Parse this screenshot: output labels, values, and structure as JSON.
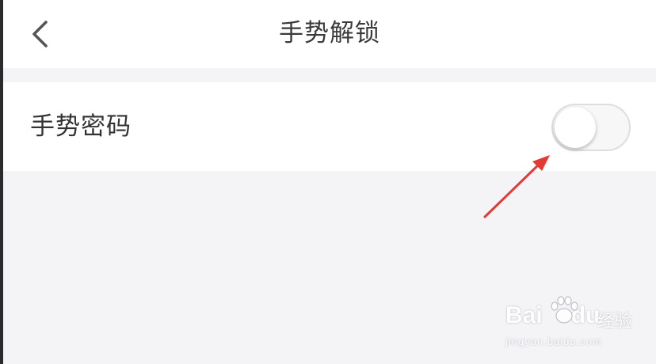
{
  "nav": {
    "title": "手势解锁",
    "back_icon": "chevron-left-icon"
  },
  "settings": {
    "gesture_password": {
      "label": "手势密码",
      "enabled": false
    }
  },
  "annotation": {
    "arrow_color": "#e53935"
  },
  "watermark": {
    "brand_lead": "Bai",
    "brand_tail": "du",
    "brand_sub": "经验",
    "url": "jingyan.baidu.com"
  },
  "colors": {
    "page_bg": "#f4f3f5",
    "card_bg": "#ffffff",
    "toggle_off_track": "#f7f7f7"
  }
}
